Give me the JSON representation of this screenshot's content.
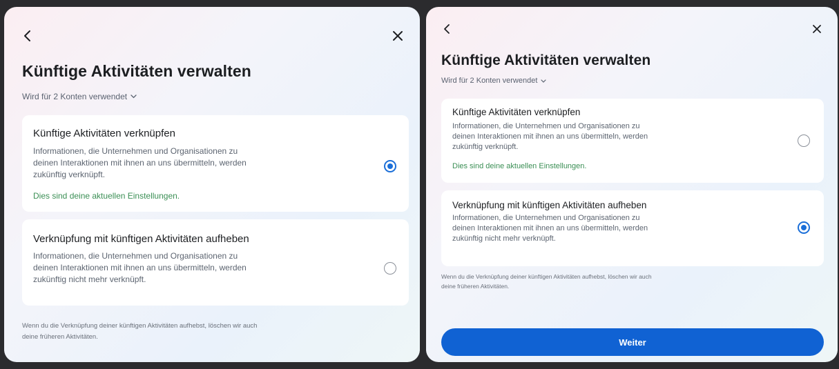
{
  "left": {
    "title": "Künftige Aktivitäten verwalten",
    "subtitle": "Wird für 2 Konten verwendet",
    "options": [
      {
        "title": "Künftige Aktivitäten verknüpfen",
        "desc_lines": [
          "Informationen, die Unternehmen und Organisationen zu",
          "deinen Interaktionen mit ihnen an uns übermitteln, werden",
          "zukünftig verknüpft."
        ],
        "current": "Dies sind deine aktuellen Einstellungen.",
        "selected": true
      },
      {
        "title": "Verknüpfung mit künftigen Aktivitäten aufheben",
        "desc_lines": [
          "Informationen, die Unternehmen und Organisationen zu",
          "deinen Interaktionen mit ihnen an uns übermitteln, werden",
          "zukünftig nicht mehr verknüpft."
        ],
        "selected": false
      }
    ],
    "footnote_lines": [
      "Wenn du die Verknüpfung deiner künftigen Aktivitäten aufhebst, löschen wir auch",
      "deine früheren Aktivitäten."
    ]
  },
  "right": {
    "title": "Künftige Aktivitäten verwalten",
    "subtitle": "Wird für 2 Konten verwendet",
    "options": [
      {
        "title": "Künftige Aktivitäten verknüpfen",
        "desc_lines": [
          "Informationen, die Unternehmen und Organisationen zu",
          "deinen Interaktionen mit ihnen an uns übermitteln, werden",
          "zukünftig verknüpft."
        ],
        "current": "Dies sind deine aktuellen Einstellungen.",
        "selected": false
      },
      {
        "title": "Verknüpfung mit künftigen Aktivitäten aufheben",
        "desc_lines": [
          "Informationen, die Unternehmen und Organisationen zu",
          "deinen Interaktionen mit ihnen an uns übermitteln, werden",
          "zukünftig nicht mehr verknüpft."
        ],
        "selected": true
      }
    ],
    "footnote_lines": [
      "Wenn du die Verknüpfung deiner künftigen Aktivitäten aufhebst, löschen wir auch",
      "deine früheren Aktivitäten."
    ],
    "continue_label": "Weiter"
  },
  "icons": {
    "back": "chevron-left-icon",
    "close": "close-icon",
    "dropdown": "chevron-down-icon"
  },
  "colors": {
    "accent": "#1062d3",
    "radio_selected": "#1a6ed8",
    "current_settings_text": "#3b8f55"
  }
}
